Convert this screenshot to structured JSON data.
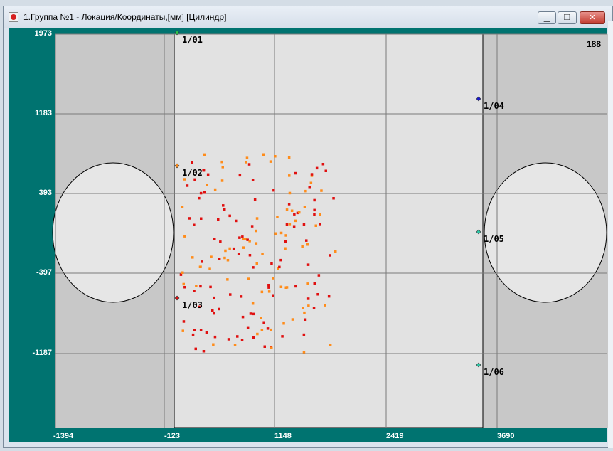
{
  "window": {
    "title": "1.Группа №1 - Локация/Координаты,[мм] [Цилиндр]",
    "minimize_label": "▁",
    "maximize_label": "❐",
    "close_label": "✕"
  },
  "plot": {
    "counter": "188",
    "y_ticks": [
      "1973",
      "1183",
      "393",
      "-397",
      "-1187"
    ],
    "x_ticks": [
      "-1394",
      "-123",
      "1148",
      "2419",
      "3690"
    ],
    "sensors": [
      {
        "label": "1/01",
        "color": "#2ec84a"
      },
      {
        "label": "1/02",
        "color": "#ff8c1a"
      },
      {
        "label": "1/03",
        "color": "#e01010"
      },
      {
        "label": "1/04",
        "color": "#1a1ad0"
      },
      {
        "label": "1/05",
        "color": "#2ec8a8"
      },
      {
        "label": "1/06",
        "color": "#2ec8a8"
      }
    ],
    "colors": {
      "background": "#007370",
      "plot_bg": "#c8c8c8",
      "sheet": "#e2e2e2",
      "grid": "#7a7a7a",
      "event_red": "#e01010",
      "event_orange": "#ff8c1a"
    }
  }
}
